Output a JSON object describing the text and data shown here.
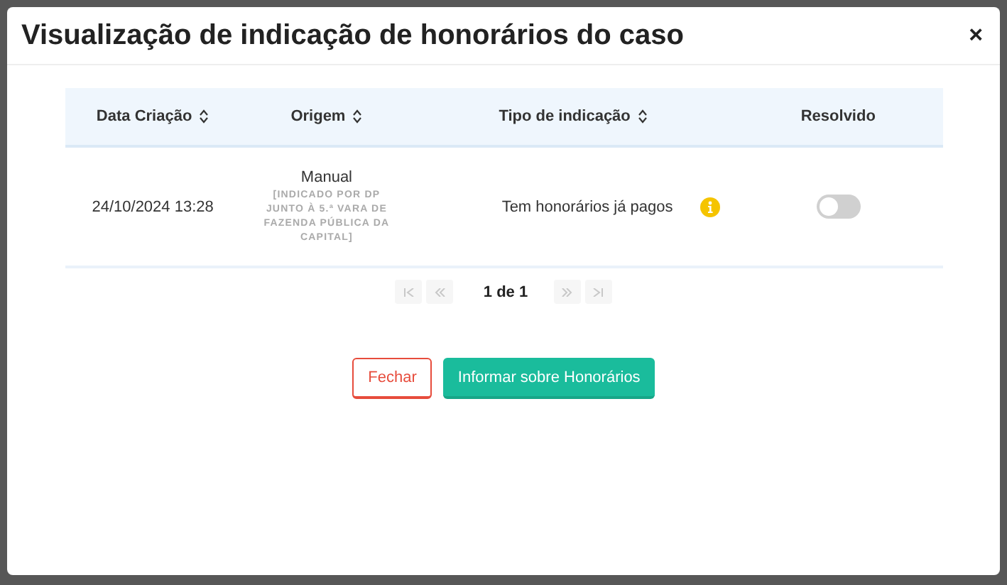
{
  "dialog": {
    "title": "Visualização de indicação de honorários do caso",
    "close": "×"
  },
  "table": {
    "columns": [
      {
        "label": "Data Criação",
        "sortable": true
      },
      {
        "label": "Origem",
        "sortable": true
      },
      {
        "label": "Tipo de indicação",
        "sortable": true
      },
      {
        "label": "Resolvido",
        "sortable": false
      }
    ],
    "rows": [
      {
        "date": "24/10/2024 13:28",
        "origin": "Manual",
        "origin_detail": "[INDICADO POR DP JUNTO À 5.ª VARA DE FAZENDA PÚBLICA DA CAPITAL]",
        "type": "Tem honorários já pagos",
        "info": true,
        "resolved": false
      }
    ]
  },
  "pagination": {
    "page_label": "1 de 1",
    "first_disabled": true,
    "prev_disabled": true,
    "next_disabled": true,
    "last_disabled": true
  },
  "buttons": [
    {
      "label": "Fechar",
      "kind": "outline"
    },
    {
      "label": "Informar sobre Honorários",
      "kind": "primary"
    }
  ]
}
